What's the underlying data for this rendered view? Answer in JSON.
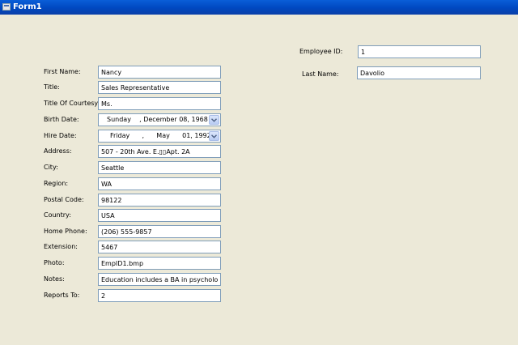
{
  "window": {
    "title": "Form1",
    "icon": "form-icon"
  },
  "header": {
    "employee_id": {
      "label": "Employee ID:",
      "value": "1"
    },
    "last_name": {
      "label": "Last Name:",
      "value": "Davolio"
    }
  },
  "fields": {
    "first_name": {
      "label": "First Name:",
      "value": "Nancy"
    },
    "title": {
      "label": "Title:",
      "value": "Sales Representative"
    },
    "title_of_courtesy": {
      "label": "Title Of Courtesy:",
      "value": "Ms."
    },
    "birth_date": {
      "label": "Birth Date:",
      "value": "Sunday    , December 08, 1968"
    },
    "hire_date": {
      "label": "Hire Date:",
      "value": "Friday      ,      May      01, 1992"
    },
    "address": {
      "label": "Address:",
      "value": "507 - 20th Ave. E.▯▯Apt. 2A"
    },
    "city": {
      "label": "City:",
      "value": "Seattle"
    },
    "region": {
      "label": "Region:",
      "value": "WA"
    },
    "postal_code": {
      "label": "Postal Code:",
      "value": "98122"
    },
    "country": {
      "label": "Country:",
      "value": "USA"
    },
    "home_phone": {
      "label": "Home Phone:",
      "value": "(206) 555-9857"
    },
    "extension": {
      "label": "Extension:",
      "value": "5467"
    },
    "photo": {
      "label": "Photo:",
      "value": "EmpID1.bmp"
    },
    "notes": {
      "label": "Notes:",
      "value": "Education includes a BA in psychology fr"
    },
    "reports_to": {
      "label": "Reports To:",
      "value": "2"
    }
  },
  "icons": {
    "dropdown": "chevron-down-icon"
  },
  "colors": {
    "titlebar": "#0048c0",
    "background": "#ece9d8",
    "input_border": "#7f9db9"
  }
}
